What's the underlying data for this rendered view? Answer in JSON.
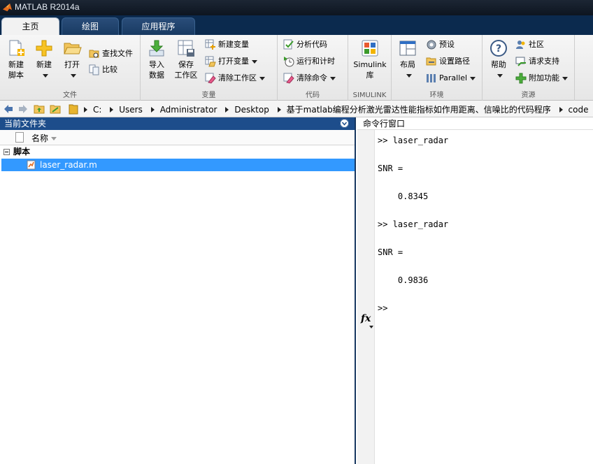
{
  "window": {
    "title": "MATLAB R2014a"
  },
  "tabs": [
    {
      "label": "主页"
    },
    {
      "label": "绘图"
    },
    {
      "label": "应用程序"
    }
  ],
  "ribbon": {
    "file": {
      "group_label": "文件",
      "new_script": "新建\n脚本",
      "new": "新建",
      "open": "打开",
      "find_files": "查找文件",
      "compare": "比较"
    },
    "variable": {
      "group_label": "变量",
      "import_data": "导入\n数据",
      "save_workspace": "保存\n工作区",
      "new_variable": "新建变量",
      "open_variable": "打开变量",
      "clear_workspace": "清除工作区"
    },
    "code": {
      "group_label": "代码",
      "analyze_code": "分析代码",
      "run_and_time": "运行和计时",
      "clear_commands": "清除命令"
    },
    "simulink": {
      "group_label": "SIMULINK",
      "simulink_library": "Simulink\n库"
    },
    "environment": {
      "group_label": "环境",
      "layout": "布局",
      "preferences": "预设",
      "set_path": "设置路径",
      "parallel": "Parallel"
    },
    "resources": {
      "group_label": "资源",
      "help": "帮助",
      "community": "社区",
      "request_support": "请求支持",
      "addons": "附加功能"
    }
  },
  "address_bar": {
    "path": [
      "C:",
      "Users",
      "Administrator",
      "Desktop",
      "基于matlab编程分析激光雷达性能指标如作用距离、信噪比的代码程序",
      "code"
    ]
  },
  "current_folder": {
    "title": "当前文件夹",
    "column_name": "名称",
    "group_label": "脚本",
    "files": [
      {
        "name": "laser_radar.m"
      }
    ]
  },
  "command_window": {
    "title": "命令行窗口",
    "lines": [
      ">> laser_radar",
      "",
      "SNR =",
      "",
      "    0.8345",
      "",
      ">> laser_radar",
      "",
      "SNR =",
      "",
      "    0.9836",
      "",
      ">>"
    ],
    "fx_label": "fx"
  },
  "colors": {
    "title_bar": "#1c2634",
    "tab_strip": "#0b2a4e",
    "panel_header": "#1d4d8b",
    "selection": "#3399ff"
  }
}
